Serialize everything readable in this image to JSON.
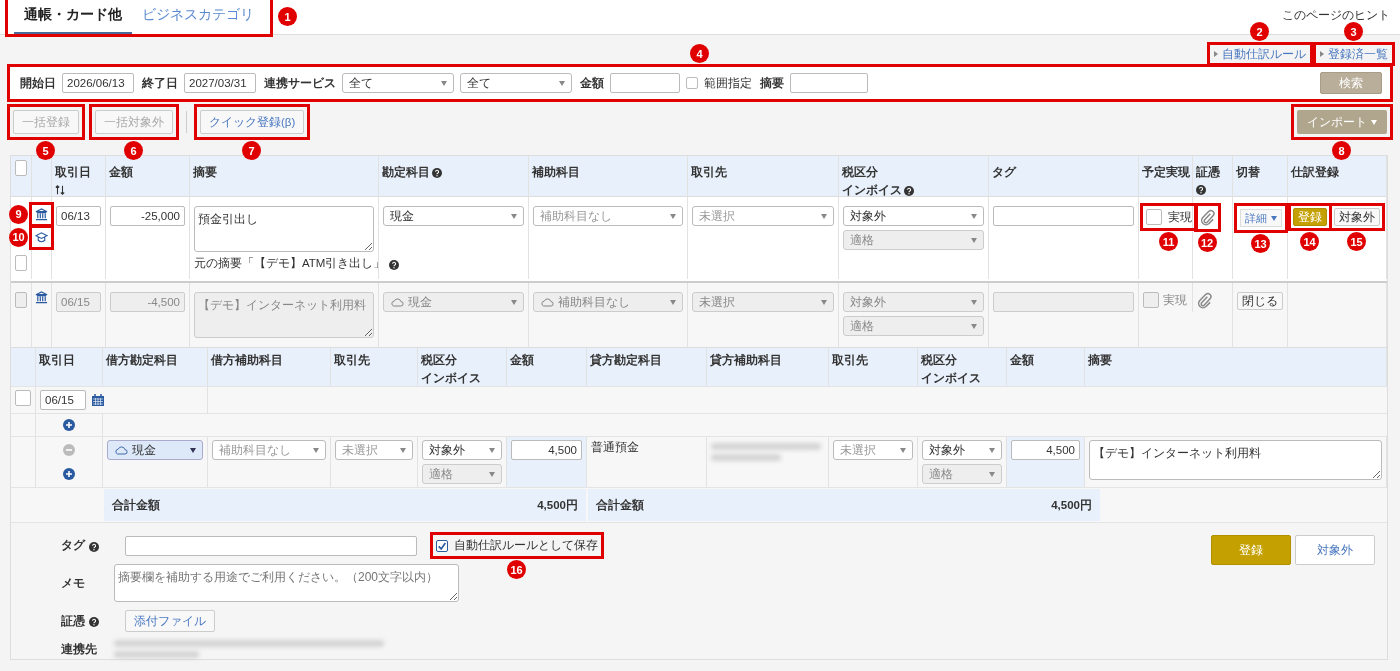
{
  "tabs": [
    {
      "label": "通帳・カード他",
      "selected": true
    },
    {
      "label": "ビジネスカテゴリ",
      "selected": false
    }
  ],
  "tabs_callout": "1",
  "hint": "このページのヒント",
  "top_links": [
    {
      "label": "自動仕訳ルール",
      "callout": "2"
    },
    {
      "label": "登録済一覧",
      "callout": "3"
    }
  ],
  "filter": {
    "callout": "4",
    "start_label": "開始日",
    "start": "2026/06/13",
    "end_label": "終了日",
    "end": "2027/03/31",
    "service_label": "連携サービス",
    "service": "全て",
    "service2": "全て",
    "amount_label": "金額",
    "range_label": "範囲指定",
    "range_checked": false,
    "summary_label": "摘要",
    "search": "検索"
  },
  "actions": [
    {
      "label": "一括登録",
      "disabled": true,
      "callout": "5"
    },
    {
      "label": "一括対象外",
      "disabled": true,
      "callout": "6"
    },
    {
      "label": "クイック登録(β)",
      "disabled": false,
      "callout": "7"
    }
  ],
  "import": {
    "label": "インポート",
    "callout": "8"
  },
  "select_all_checked": false,
  "columns": [
    {
      "label": "取引日",
      "sort": true,
      "help": false
    },
    {
      "label": "金額",
      "sort": false,
      "help": false
    },
    {
      "label": "摘要",
      "sort": false,
      "help": false
    },
    {
      "label": "勘定科目",
      "sort": false,
      "help": true
    },
    {
      "label": "補助科目",
      "sort": false,
      "help": false
    },
    {
      "label": "取引先",
      "sort": false,
      "help": false
    },
    {
      "label": "税区分",
      "sub_label": "インボイス",
      "sort": false,
      "help": true
    },
    {
      "label": "タグ",
      "sort": false,
      "help": false
    },
    {
      "label": "予定実現",
      "sort": false,
      "help": false
    },
    {
      "label": "証憑",
      "sort": false,
      "help": true
    },
    {
      "label": "切替",
      "sort": false,
      "help": false
    },
    {
      "label": "仕訳登録",
      "sort": false,
      "help": false
    }
  ],
  "row1": {
    "checked": false,
    "bank_callout": "9",
    "cap_callout": "10",
    "date": "06/13",
    "amount": "-25,000",
    "summary": "預金引出し",
    "original_summary": "元の摘要「【デモ】ATM引き出し」",
    "account": "現金",
    "sub_account": "補助科目なし",
    "partner": "未選択",
    "tax": "対象外",
    "invoice": "適格",
    "realized_label": "実現",
    "realized": false,
    "realized_callout": "11",
    "clip_callout": "12",
    "switch": "詳細",
    "switch_callout": "13",
    "register": "登録",
    "register_callout": "14",
    "exclude": "対象外",
    "exclude_callout": "15"
  },
  "row2": {
    "checked": false,
    "date": "06/15",
    "amount": "-4,500",
    "summary": "【デモ】インターネット利用料",
    "account": "現金",
    "sub_account": "補助科目なし",
    "partner": "未選択",
    "tax": "対象外",
    "invoice": "適格",
    "realized_label": "実現",
    "realized": false,
    "close": "閉じる"
  },
  "detail": {
    "columns": [
      {
        "label": "取引日"
      },
      {
        "label": "借方勘定科目"
      },
      {
        "label": "借方補助科目"
      },
      {
        "label": "取引先"
      },
      {
        "label": "税区分",
        "sub_label": "インボイス"
      },
      {
        "label": "金額"
      },
      {
        "label": "貸方勘定科目"
      },
      {
        "label": "貸方補助科目"
      },
      {
        "label": "取引先"
      },
      {
        "label": "税区分",
        "sub_label": "インボイス"
      },
      {
        "label": "金額"
      },
      {
        "label": "摘要"
      }
    ],
    "checked": false,
    "date": "06/15",
    "debit": {
      "account": "現金",
      "sub_account": "補助科目なし",
      "partner": "未選択",
      "tax": "対象外",
      "invoice": "適格",
      "amount": "4,500"
    },
    "credit": {
      "account": "普通預金",
      "partner": "未選択",
      "tax": "対象外",
      "invoice": "適格",
      "amount": "4,500"
    },
    "summary": "【デモ】インターネット利用料",
    "totals": [
      {
        "label": "合計金額",
        "value": "4,500円"
      },
      {
        "label": "合計金額",
        "value": "4,500円"
      }
    ],
    "tag_label": "タグ",
    "memo_label": "メモ",
    "memo_placeholder": "摘要欄を補助する用途でご利用ください。（200文字以内）",
    "evidence_label": "証憑",
    "attach": "添付ファイル",
    "link_label": "連携先",
    "save_rule": {
      "label": "自動仕訳ルールとして保存",
      "checked": true,
      "callout": "16"
    },
    "register": "登録",
    "exclude": "対象外"
  }
}
